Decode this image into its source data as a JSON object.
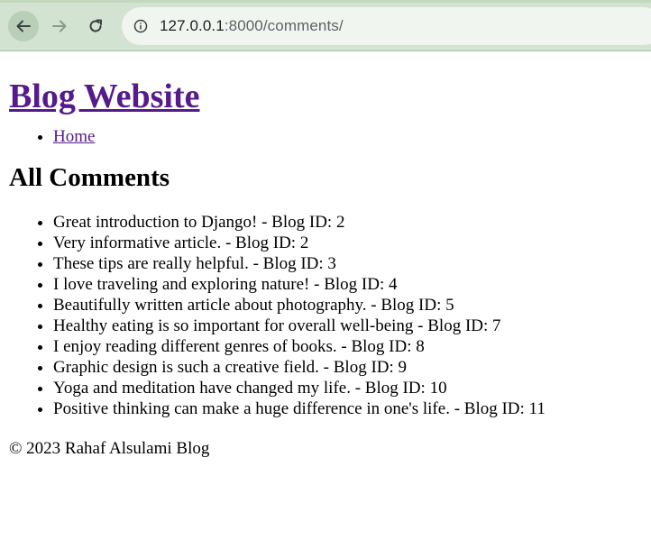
{
  "browser": {
    "url_host": "127.0.0.1",
    "url_rest": ":8000/comments/"
  },
  "site": {
    "title": "Blog Website"
  },
  "nav": {
    "items": [
      {
        "label": "Home"
      }
    ]
  },
  "main": {
    "heading": "All Comments",
    "comments": [
      "Great introduction to Django! - Blog ID: 2",
      "Very informative article. - Blog ID: 2",
      "These tips are really helpful. - Blog ID: 3",
      "I love traveling and exploring nature! - Blog ID: 4",
      "Beautifully written article about photography. - Blog ID: 5",
      "Healthy eating is so important for overall well-being - Blog ID: 7",
      "I enjoy reading different genres of books. - Blog ID: 8",
      "Graphic design is such a creative field. - Blog ID: 9",
      "Yoga and meditation have changed my life. - Blog ID: 10",
      "Positive thinking can make a huge difference in one's life. - Blog ID: 11"
    ]
  },
  "footer": {
    "text": "© 2023 Rahaf Alsulami Blog"
  },
  "colors": {
    "toolbar_bg": "#d3e3d1",
    "omnibox_bg": "#f1f5f0",
    "link_visited": "#551a8b"
  }
}
